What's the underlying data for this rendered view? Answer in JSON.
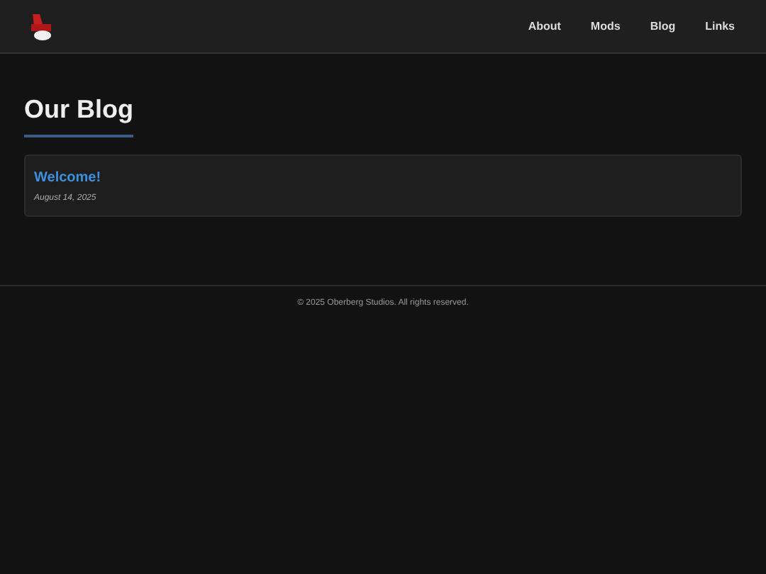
{
  "nav": [
    {
      "label": "About"
    },
    {
      "label": "Mods"
    },
    {
      "label": "Blog"
    },
    {
      "label": "Links"
    }
  ],
  "heading": "Our Blog",
  "posts": [
    {
      "title": "Welcome!",
      "date": "August 14, 2025"
    }
  ],
  "footer": "© 2025 Oberberg Studios. All rights reserved."
}
